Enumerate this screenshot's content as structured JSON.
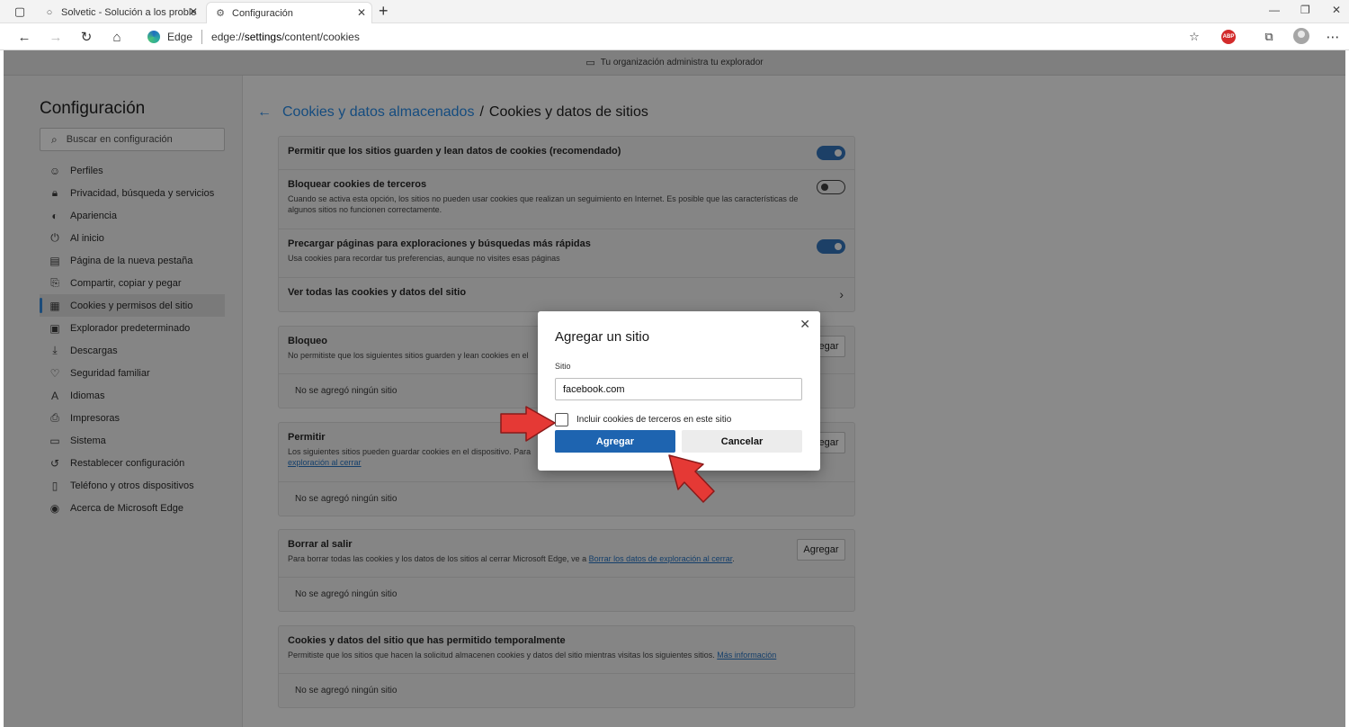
{
  "browser": {
    "tabs": [
      {
        "title": "Solvetic - Solución a los problemas informáticos",
        "close": "✕"
      },
      {
        "title": "Configuración",
        "close": "✕"
      }
    ],
    "new_tab": "+",
    "window_controls": {
      "minimize": "—",
      "restore": "❐",
      "close": "✕"
    },
    "address": {
      "brand": "Edge",
      "url_prefix": "edge://",
      "url_bold": "settings",
      "url_suffix": "/content/cookies"
    },
    "extension_label": "ABP"
  },
  "org_notice": "Tu organización administra tu explorador",
  "sidebar": {
    "title": "Configuración",
    "search_placeholder": "Buscar en configuración",
    "items": [
      {
        "label": "Perfiles",
        "icon": "profile-icon"
      },
      {
        "label": "Privacidad, búsqueda y servicios",
        "icon": "lock-icon"
      },
      {
        "label": "Apariencia",
        "icon": "appearance-icon"
      },
      {
        "label": "Al inicio",
        "icon": "power-icon"
      },
      {
        "label": "Página de la nueva pestaña",
        "icon": "newtab-icon"
      },
      {
        "label": "Compartir, copiar y pegar",
        "icon": "share-icon"
      },
      {
        "label": "Cookies y permisos del sitio",
        "icon": "cookies-icon",
        "active": true
      },
      {
        "label": "Explorador predeterminado",
        "icon": "browser-icon"
      },
      {
        "label": "Descargas",
        "icon": "download-icon"
      },
      {
        "label": "Seguridad familiar",
        "icon": "family-icon"
      },
      {
        "label": "Idiomas",
        "icon": "language-icon"
      },
      {
        "label": "Impresoras",
        "icon": "printer-icon"
      },
      {
        "label": "Sistema",
        "icon": "system-icon"
      },
      {
        "label": "Restablecer configuración",
        "icon": "reset-icon"
      },
      {
        "label": "Teléfono y otros dispositivos",
        "icon": "phone-icon"
      },
      {
        "label": "Acerca de Microsoft Edge",
        "icon": "edge-icon"
      }
    ]
  },
  "page": {
    "breadcrumb_parent": "Cookies y datos almacenados",
    "breadcrumb_sep": "/",
    "breadcrumb_current": "Cookies y datos de sitios"
  },
  "settings": {
    "allow": {
      "title": "Permitir que los sitios guarden y lean datos de cookies (recomendado)",
      "on": true
    },
    "block_third": {
      "title": "Bloquear cookies de terceros",
      "desc": "Cuando se activa esta opción, los sitios no pueden usar cookies que realizan un seguimiento en Internet. Es posible que las características de algunos sitios no funcionen correctamente.",
      "on": false
    },
    "preload": {
      "title": "Precargar páginas para exploraciones y búsquedas más rápidas",
      "desc": "Usa cookies para recordar tus preferencias, aunque no visites esas páginas",
      "on": true
    },
    "see_all": {
      "title": "Ver todas las cookies y datos del sitio"
    }
  },
  "sections": {
    "block": {
      "title": "Bloqueo",
      "desc": "No permitiste que los siguientes sitios guarden y lean cookies en el",
      "add": "Agregar",
      "empty": "No se agregó ningún sitio"
    },
    "allow": {
      "title": "Permitir",
      "desc": "Los siguientes sitios pueden guardar cookies en el dispositivo. Para",
      "link": "exploración al cerrar",
      "add": "Agregar",
      "empty": "No se agregó ningún sitio"
    },
    "clear": {
      "title": "Borrar al salir",
      "desc": "Para borrar todas las cookies y los datos de los sitios al cerrar Microsoft Edge, ve a",
      "link": "Borrar los datos de exploración al cerrar",
      "add": "Agregar",
      "empty": "No se agregó ningún sitio"
    },
    "temp": {
      "title": "Cookies y datos del sitio que has permitido temporalmente",
      "desc": "Permitiste que los sitios que hacen la solicitud almacenen cookies y datos del sitio mientras visitas los siguientes sitios.",
      "link": "Más información",
      "empty": "No se agregó ningún sitio"
    }
  },
  "dialog": {
    "title": "Agregar un sitio",
    "label": "Sitio",
    "value": "facebook.com",
    "checkbox_label": "Incluir cookies de terceros en este sitio",
    "checkbox_checked": false,
    "primary": "Agregar",
    "secondary": "Cancelar"
  },
  "colors": {
    "accent": "#1e64b0",
    "arrow": "#e53935"
  }
}
